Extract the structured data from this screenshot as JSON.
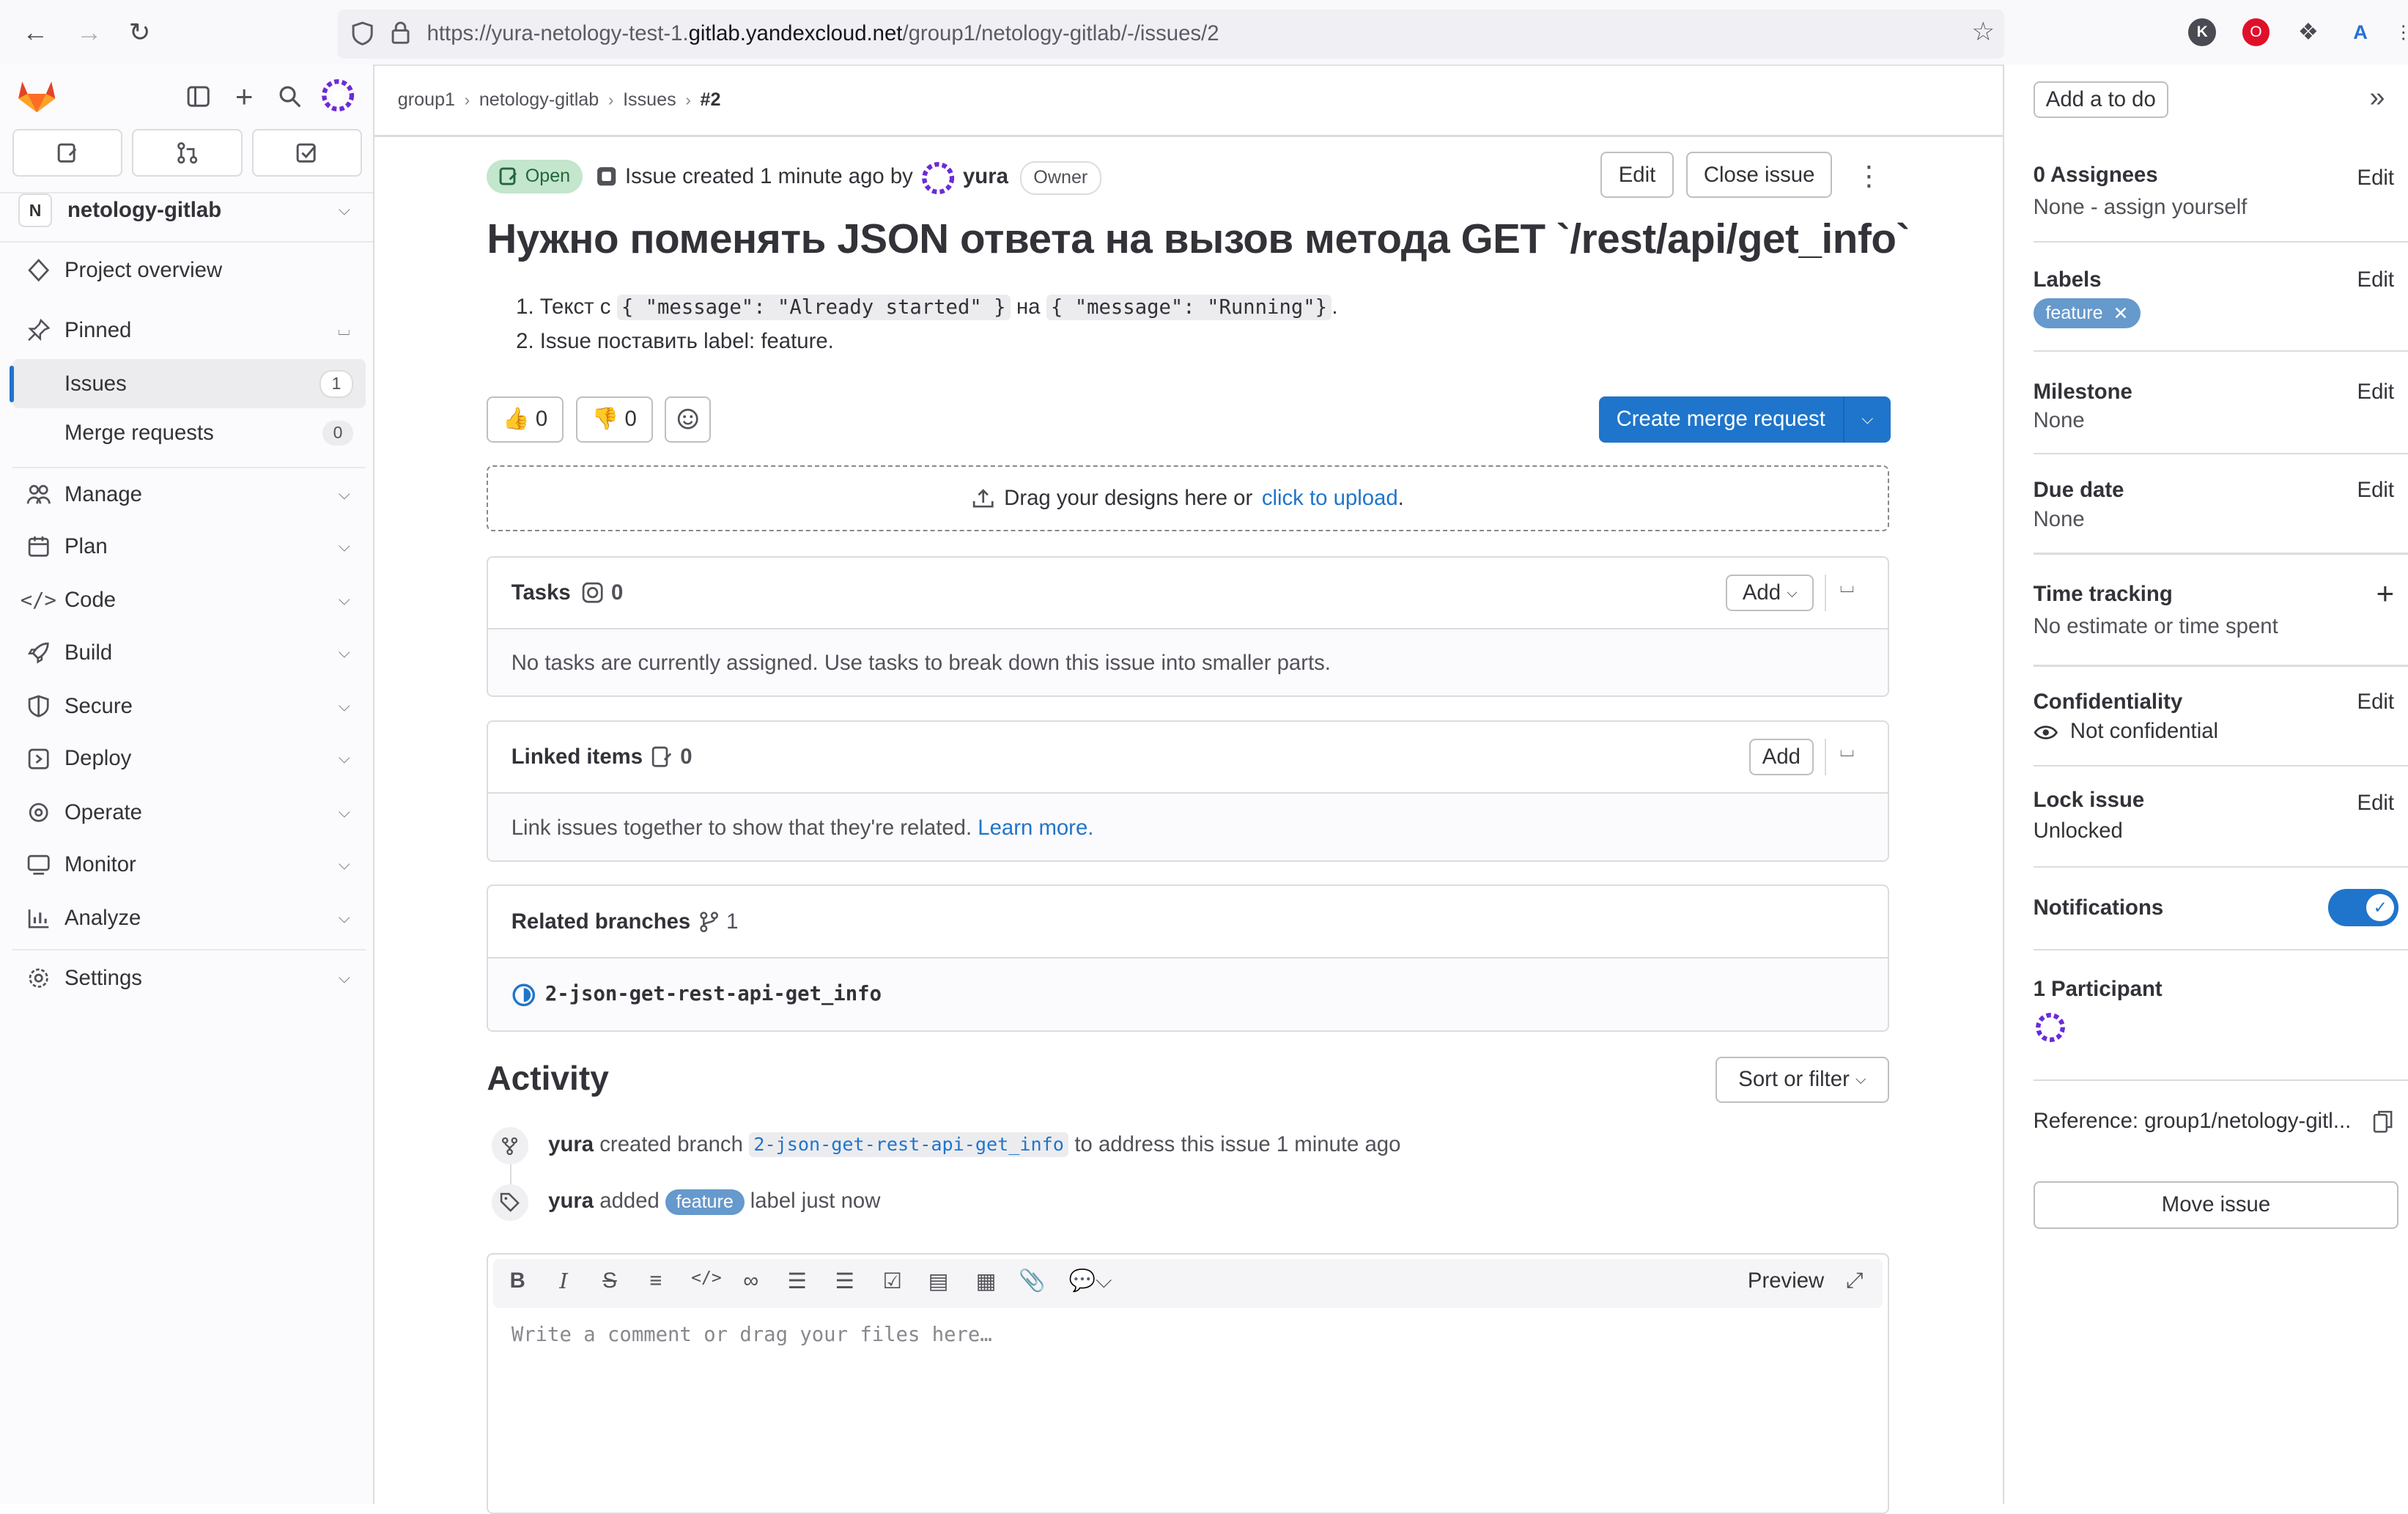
{
  "browser": {
    "url_prefix": "https://yura-netology-test-1.",
    "url_domain": "gitlab.yandexcloud.net",
    "url_path": "/group1/netology-gitlab/-/issues/2"
  },
  "sidebar": {
    "project_initial": "N",
    "project_name": "netology-gitlab",
    "project_overview": "Project overview",
    "pinned": "Pinned",
    "issues": "Issues",
    "issues_count": "1",
    "merge_requests": "Merge requests",
    "merge_requests_count": "0",
    "groups": [
      "Manage",
      "Plan",
      "Code",
      "Build",
      "Secure",
      "Deploy",
      "Operate",
      "Monitor",
      "Analyze",
      "Settings"
    ]
  },
  "breadcrumb": [
    "group1",
    "netology-gitlab",
    "Issues",
    "#2"
  ],
  "issue": {
    "status": "Open",
    "meta": "Issue created 1 minute ago by",
    "author": "yura",
    "role": "Owner",
    "edit": "Edit",
    "close": "Close issue",
    "title": "Нужно поменять JSON ответа на вызов метода GET `/rest/api/get_info`",
    "desc_1_pre": "Текст с",
    "desc_1_code_a": "{ \"message\": \"Already started\" }",
    "desc_1_mid": "на",
    "desc_1_code_b": "{ \"message\": \"Running\"}",
    "desc_1_post": ".",
    "desc_2": "Issue поставить label: feature.",
    "thumbs_up": "0",
    "thumbs_down": "0",
    "create_mr": "Create merge request",
    "upload_text": "Drag your designs here or",
    "upload_link": "click to upload",
    "upload_dot": "."
  },
  "tasks": {
    "title": "Tasks",
    "count": "0",
    "add": "Add",
    "empty": "No tasks are currently assigned. Use tasks to break down this issue into smaller parts."
  },
  "linked": {
    "title": "Linked items",
    "count": "0",
    "add": "Add",
    "empty": "Link issues together to show that they're related.",
    "learn": "Learn more."
  },
  "branches": {
    "title": "Related branches",
    "count": "1",
    "branch": "2-json-get-rest-api-get_info"
  },
  "activity": {
    "title": "Activity",
    "sort": "Sort or filter",
    "e1_user": "yura",
    "e1_text": "created branch",
    "e1_branch": "2-json-get-rest-api-get_info",
    "e1_tail": "to address this issue 1 minute ago",
    "e2_user": "yura",
    "e2_text": "added",
    "e2_label": "feature",
    "e2_tail": "label just now"
  },
  "editor": {
    "preview": "Preview",
    "placeholder": "Write a comment or drag your files here…"
  },
  "right": {
    "todo": "Add a to do",
    "assignees_title": "0 Assignees",
    "assignees_val": "None - assign yourself",
    "labels_title": "Labels",
    "label": "feature",
    "milestone_title": "Milestone",
    "milestone_val": "None",
    "due_title": "Due date",
    "due_val": "None",
    "time_title": "Time tracking",
    "time_val": "No estimate or time spent",
    "conf_title": "Confidentiality",
    "conf_val": "Not confidential",
    "lock_title": "Lock issue",
    "lock_val": "Unlocked",
    "notif_title": "Notifications",
    "participants": "1 Participant",
    "reference": "Reference: group1/netology-gitl...",
    "move": "Move issue",
    "edit": "Edit"
  },
  "colors": {
    "accent": "#1f75cb",
    "open_green": "#c3e6cd",
    "label_blue": "#6699cc"
  }
}
